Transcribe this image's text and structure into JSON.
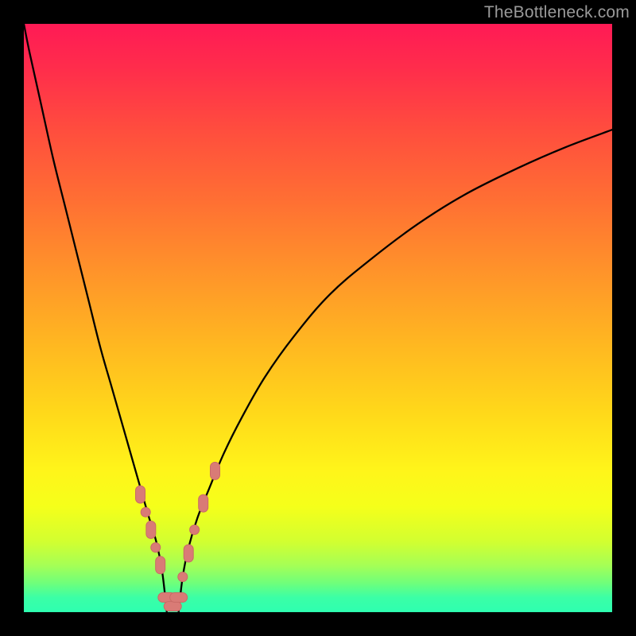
{
  "watermark": "TheBottleneck.com",
  "colors": {
    "curve": "#000000",
    "marker_fill": "#d97b76",
    "marker_stroke": "#c96b66",
    "frame": "#000000"
  },
  "chart_data": {
    "type": "line",
    "title": "",
    "xlabel": "",
    "ylabel": "",
    "xlim": [
      0,
      100
    ],
    "ylim": [
      0,
      100
    ],
    "grid": false,
    "series": [
      {
        "name": "left-branch",
        "x": [
          0,
          1,
          3,
          5,
          7,
          9,
          11,
          13,
          15,
          17,
          19,
          21,
          22.5,
          23.5,
          24.3
        ],
        "y": [
          100,
          95,
          86,
          77,
          69,
          61,
          53,
          45,
          38,
          31,
          24,
          17,
          12,
          7,
          0
        ]
      },
      {
        "name": "right-branch",
        "x": [
          26.3,
          27,
          28,
          29.5,
          31.5,
          34,
          37,
          41,
          46,
          52,
          59,
          67,
          75,
          84,
          92,
          100
        ],
        "y": [
          0,
          6,
          11,
          16,
          21,
          27,
          33,
          40,
          47,
          54,
          60,
          66,
          71,
          75.5,
          79,
          82
        ]
      }
    ],
    "markers": [
      {
        "x": 19.8,
        "y": 20.0,
        "kind": "capsule-v"
      },
      {
        "x": 20.7,
        "y": 17.0,
        "kind": "dot"
      },
      {
        "x": 21.6,
        "y": 14.0,
        "kind": "capsule-v"
      },
      {
        "x": 22.4,
        "y": 11.0,
        "kind": "dot"
      },
      {
        "x": 23.2,
        "y": 8.0,
        "kind": "capsule-v"
      },
      {
        "x": 24.3,
        "y": 2.5,
        "kind": "capsule-h"
      },
      {
        "x": 25.3,
        "y": 1.0,
        "kind": "capsule-h"
      },
      {
        "x": 26.3,
        "y": 2.5,
        "kind": "capsule-h"
      },
      {
        "x": 27.0,
        "y": 6.0,
        "kind": "dot"
      },
      {
        "x": 28.0,
        "y": 10.0,
        "kind": "capsule-v"
      },
      {
        "x": 29.0,
        "y": 14.0,
        "kind": "dot"
      },
      {
        "x": 30.5,
        "y": 18.5,
        "kind": "capsule-v"
      },
      {
        "x": 32.5,
        "y": 24.0,
        "kind": "capsule-v"
      }
    ],
    "note": "Values estimated from pixels; y is percent of plot height from bottom, x is percent of plot width from left."
  }
}
